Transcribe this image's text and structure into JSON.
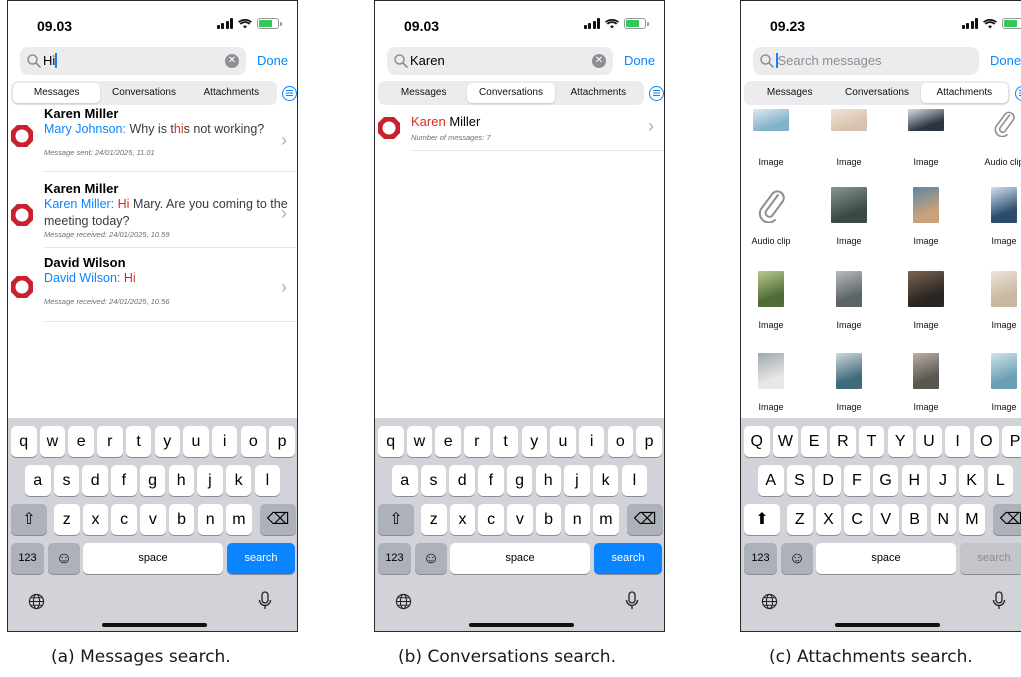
{
  "captions": {
    "a": "(a) Messages search.",
    "b": "(b) Conversations search.",
    "c": "(c) Attachments search."
  },
  "tabs": [
    "Messages",
    "Conversations",
    "Attachments"
  ],
  "done_label": "Done",
  "accent_color": "#0a84ff",
  "highlight_color": "#e0291d",
  "keyboard": {
    "row1_lower": [
      "q",
      "w",
      "e",
      "r",
      "t",
      "y",
      "u",
      "i",
      "o",
      "p"
    ],
    "row2_lower": [
      "a",
      "s",
      "d",
      "f",
      "g",
      "h",
      "j",
      "k",
      "l"
    ],
    "row3_lower": [
      "z",
      "x",
      "c",
      "v",
      "b",
      "n",
      "m"
    ],
    "row1_upper": [
      "Q",
      "W",
      "E",
      "R",
      "T",
      "Y",
      "U",
      "I",
      "O",
      "P"
    ],
    "row2_upper": [
      "A",
      "S",
      "D",
      "F",
      "G",
      "H",
      "J",
      "K",
      "L"
    ],
    "row3_upper": [
      "Z",
      "X",
      "C",
      "V",
      "B",
      "N",
      "M"
    ],
    "numbers_label": "123",
    "space_label": "space",
    "search_label": "search"
  },
  "phone_a": {
    "time": "09.03",
    "search_value": "Hi",
    "active_tab": "Messages",
    "results": [
      {
        "name": "Karen Miller",
        "sender": "Mary Johnson:",
        "text_pre": " Why is t",
        "text_hit": "hi",
        "text_post": "s not working?",
        "meta": "Message sent: 24/01/2025, 11.01"
      },
      {
        "name": "Karen Miller",
        "sender": "Karen Miller:",
        "text_pre": " ",
        "text_hit": "Hi",
        "text_post": " Mary. Are you coming to the meeting today?",
        "meta": "Message received: 24/01/2025, 10.59"
      },
      {
        "name": "David Wilson",
        "sender": "David Wilson:",
        "text_pre": " ",
        "text_hit": "Hi",
        "text_post": "",
        "meta": "Message received: 24/01/2025, 10.56"
      }
    ]
  },
  "phone_b": {
    "time": "09.03",
    "search_value": "Karen",
    "active_tab": "Conversations",
    "result": {
      "name_hit": "Karen",
      "name_rest": " Miller",
      "meta": "Number of messages: 7"
    }
  },
  "phone_c": {
    "time": "09.23",
    "search_placeholder": "Search messages",
    "active_tab": "Attachments",
    "attachments": [
      {
        "label": "Image",
        "icon": "image-thumb"
      },
      {
        "label": "Image",
        "icon": "image-thumb"
      },
      {
        "label": "Image",
        "icon": "image-thumb"
      },
      {
        "label": "Audio clip",
        "icon": "paperclip-icon"
      },
      {
        "label": "Audio clip",
        "icon": "paperclip-icon"
      },
      {
        "label": "Image",
        "icon": "image-thumb"
      },
      {
        "label": "Image",
        "icon": "image-thumb"
      },
      {
        "label": "Image",
        "icon": "image-thumb"
      },
      {
        "label": "Image",
        "icon": "image-thumb"
      },
      {
        "label": "Image",
        "icon": "image-thumb"
      },
      {
        "label": "Image",
        "icon": "image-thumb"
      },
      {
        "label": "Image",
        "icon": "image-thumb"
      },
      {
        "label": "Image",
        "icon": "image-thumb"
      },
      {
        "label": "Image",
        "icon": "image-thumb"
      },
      {
        "label": "Image",
        "icon": "image-thumb"
      },
      {
        "label": "Image",
        "icon": "image-thumb"
      }
    ]
  }
}
